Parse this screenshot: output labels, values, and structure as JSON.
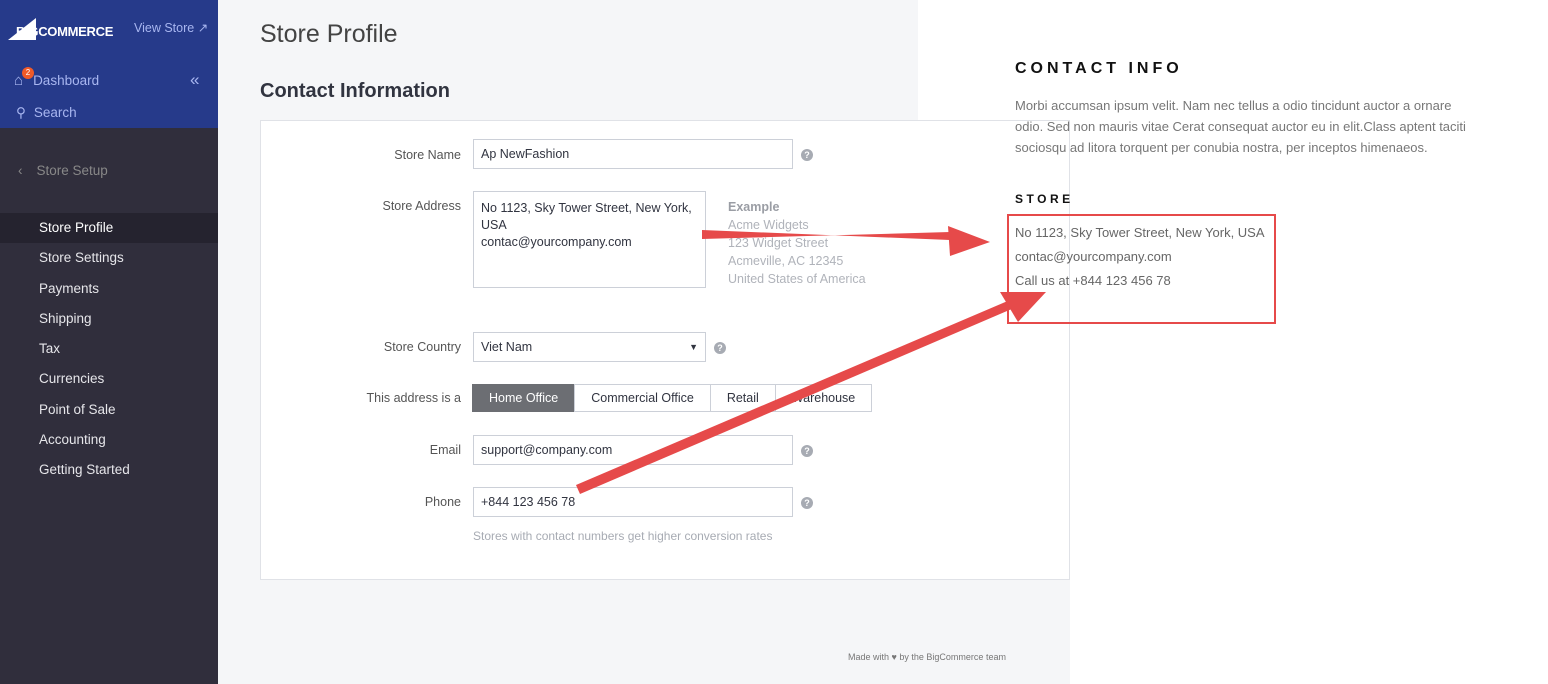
{
  "sidebar": {
    "logo": "BIGCOMMERCE",
    "view_store": "View Store",
    "dashboard": "Dashboard",
    "badge": "2",
    "search": "Search",
    "section": "Store Setup",
    "items": [
      "Store Profile",
      "Store Settings",
      "Payments",
      "Shipping",
      "Tax",
      "Currencies",
      "Point of Sale",
      "Accounting",
      "Getting Started"
    ]
  },
  "main": {
    "title": "Store Profile",
    "section": "Contact Information",
    "form": {
      "store_name_label": "Store Name",
      "store_name": "Ap NewFashion",
      "address_label": "Store Address",
      "address": "No 1123, Sky Tower Street, New York, USA\ncontac@yourcompany.com",
      "example_title": "Example",
      "example_lines": [
        "Acme Widgets",
        "123 Widget Street",
        "Acmeville, AC 12345",
        "United States of America"
      ],
      "country_label": "Store Country",
      "country": "Viet Nam",
      "type_label": "This address is a",
      "types": [
        "Home Office",
        "Commercial Office",
        "Retail",
        "Warehouse"
      ],
      "selected_type": "Home Office",
      "email_label": "Email",
      "email": "support@company.com",
      "phone_label": "Phone",
      "phone": "+844 123 456 78",
      "phone_hint": "Stores with contact numbers get higher conversion rates"
    },
    "footer_pre": "Made with",
    "footer_post": "by the BigCommerce team"
  },
  "storefront": {
    "heading": "CONTACT INFO",
    "body": "Morbi accumsan ipsum velit. Nam nec tellus a odio tincidunt auctor a ornare odio. Sed non mauris vitae Cerat consequat auctor eu in elit.Class aptent taciti sociosqu ad litora torquent per conubia nostra, per inceptos himenaeos.",
    "store_heading": "STORE",
    "lines": [
      "No 1123, Sky Tower Street, New York, USA",
      "contac@yourcompany.com",
      "Call us at +844 123 456 78"
    ]
  },
  "colors": {
    "sidebar_top": "#263a8a",
    "sidebar": "#302e3c",
    "arrow": "#e64a4a"
  }
}
